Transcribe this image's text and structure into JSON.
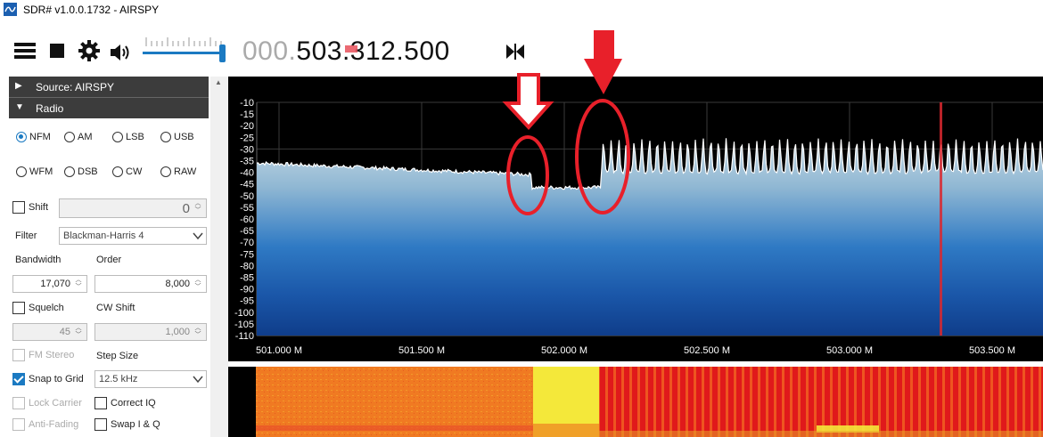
{
  "window": {
    "title": "SDR# v1.0.0.1732 - AIRSPY"
  },
  "toolbar": {
    "frequency_dim": "000.",
    "frequency_bright": "503.312.500"
  },
  "panel": {
    "source_header": "Source: AIRSPY",
    "radio_header": "Radio",
    "modes": [
      "NFM",
      "AM",
      "LSB",
      "USB",
      "WFM",
      "DSB",
      "CW",
      "RAW"
    ],
    "selected_mode": "NFM",
    "shift_label": "Shift",
    "shift_value": "0",
    "filter_label": "Filter",
    "filter_value": "Blackman-Harris 4",
    "bandwidth_label": "Bandwidth",
    "bandwidth_value": "17,070",
    "order_label": "Order",
    "order_value": "8,000",
    "squelch_label": "Squelch",
    "squelch_value": "45",
    "cwshift_label": "CW Shift",
    "cwshift_value": "1,000",
    "fmstereo_label": "FM Stereo",
    "stepsize_label": "Step Size",
    "snap_label": "Snap to Grid",
    "stepsize_value": "12.5 kHz",
    "lockcarrier_label": "Lock Carrier",
    "correctiq_label": "Correct IQ",
    "antifading_label": "Anti-Fading",
    "swapiq_label": "Swap I & Q"
  },
  "spectrum": {
    "y_labels": [
      "-10",
      "-15",
      "-20",
      "-25",
      "-30",
      "-35",
      "-40",
      "-45",
      "-50",
      "-55",
      "-60",
      "-65",
      "-70",
      "-75",
      "-80",
      "-85",
      "-90",
      "-95",
      "-100",
      "-105",
      "-110"
    ],
    "x_labels": [
      "501.000 M",
      "501.500 M",
      "502.000 M",
      "502.500 M",
      "503.000 M",
      "503.500 M"
    ]
  },
  "colors": {
    "accent": "#1b7ac2",
    "header_bg": "#3c3c3c",
    "annotation_red": "#e8202a",
    "spectrum_bg": "#000000"
  }
}
